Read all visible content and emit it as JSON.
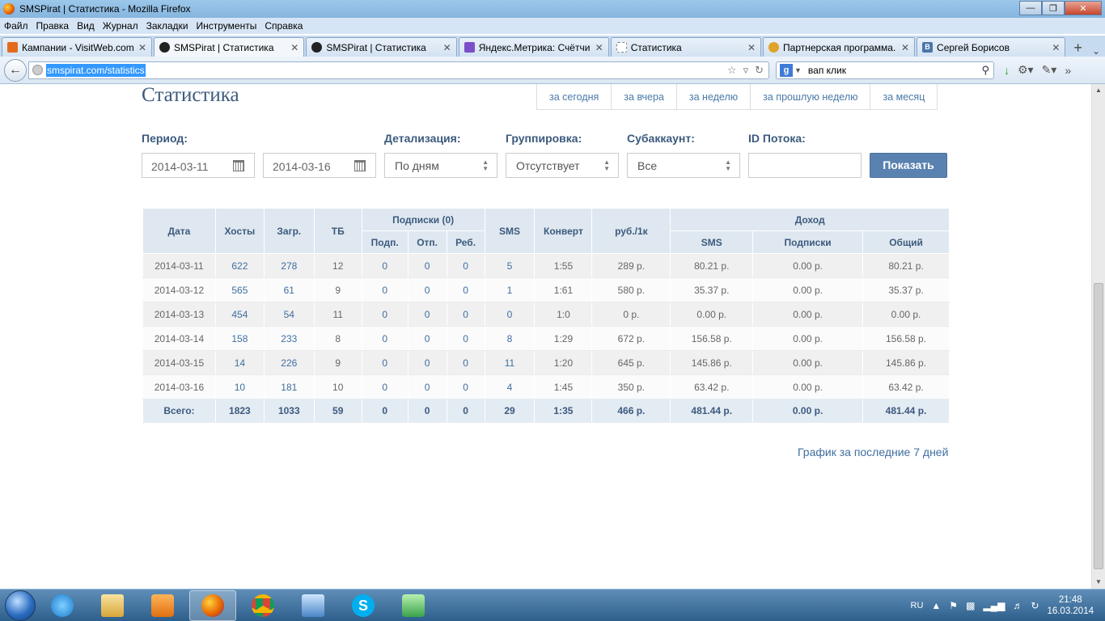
{
  "window": {
    "title": "SMSPirat | Статистика - Mozilla Firefox"
  },
  "menu": [
    "Файл",
    "Правка",
    "Вид",
    "Журнал",
    "Закладки",
    "Инструменты",
    "Справка"
  ],
  "tabs": [
    {
      "label": "Кампании - VisitWeb.com",
      "color": "#e36b1f"
    },
    {
      "label": "SMSPirat | Статистика",
      "color": "#222222"
    },
    {
      "label": "SMSPirat | Статистика",
      "color": "#222222"
    },
    {
      "label": "Яндекс.Метрика: Счётчики",
      "color": "#7b4fc9"
    },
    {
      "label": "Статистика",
      "color": "#ffffff"
    },
    {
      "label": "Партнерская программа...",
      "color": "#e0a32a"
    },
    {
      "label": "Сергей Борисов",
      "color": "#4a76a8"
    }
  ],
  "nav": {
    "url": "smspirat.com/statistics",
    "search_engine": "g",
    "search_value": "вап клик"
  },
  "page": {
    "title": "Статистика",
    "quick_links": [
      "за сегодня",
      "за вчера",
      "за неделю",
      "за прошлую неделю",
      "за месяц"
    ],
    "filters": {
      "period_label": "Период:",
      "date_from": "2014-03-11",
      "date_to": "2014-03-16",
      "detail_label": "Детализация:",
      "detail_value": "По дням",
      "group_label": "Группировка:",
      "group_value": "Отсутствует",
      "subaccount_label": "Субаккаунт:",
      "subaccount_value": "Все",
      "stream_label": "ID Потока:",
      "stream_value": "",
      "show_button": "Показать"
    },
    "table": {
      "headers": {
        "date": "Дата",
        "hosts": "Хосты",
        "loads": "Загр.",
        "tb": "ТБ",
        "subs": "Подписки (0)",
        "subs_sub": "Подп.",
        "subs_unsub": "Отп.",
        "subs_reb": "Реб.",
        "sms": "SMS",
        "conv": "Конверт",
        "rub1k": "руб./1к",
        "income": "Доход",
        "income_sms": "SMS",
        "income_subs": "Подписки",
        "income_total": "Общий"
      },
      "rows": [
        [
          "2014-03-11",
          "622",
          "278",
          "12",
          "0",
          "0",
          "0",
          "5",
          "1:55",
          "289 р.",
          "80.21 р.",
          "0.00 р.",
          "80.21 р."
        ],
        [
          "2014-03-12",
          "565",
          "61",
          "9",
          "0",
          "0",
          "0",
          "1",
          "1:61",
          "580 р.",
          "35.37 р.",
          "0.00 р.",
          "35.37 р."
        ],
        [
          "2014-03-13",
          "454",
          "54",
          "11",
          "0",
          "0",
          "0",
          "0",
          "1:0",
          "0 р.",
          "0.00 р.",
          "0.00 р.",
          "0.00 р."
        ],
        [
          "2014-03-14",
          "158",
          "233",
          "8",
          "0",
          "0",
          "0",
          "8",
          "1:29",
          "672 р.",
          "156.58 р.",
          "0.00 р.",
          "156.58 р."
        ],
        [
          "2014-03-15",
          "14",
          "226",
          "9",
          "0",
          "0",
          "0",
          "11",
          "1:20",
          "645 р.",
          "145.86 р.",
          "0.00 р.",
          "145.86 р."
        ],
        [
          "2014-03-16",
          "10",
          "181",
          "10",
          "0",
          "0",
          "0",
          "4",
          "1:45",
          "350 р.",
          "63.42 р.",
          "0.00 р.",
          "63.42 р."
        ]
      ],
      "total": [
        "Всего:",
        "1823",
        "1033",
        "59",
        "0",
        "0",
        "0",
        "29",
        "1:35",
        "466 р.",
        "481.44 р.",
        "0.00 р.",
        "481.44 р."
      ]
    },
    "graph_link": "График за последние 7 дней"
  },
  "taskbar": {
    "lang": "RU",
    "time": "21:48",
    "date": "16.03.2014"
  }
}
